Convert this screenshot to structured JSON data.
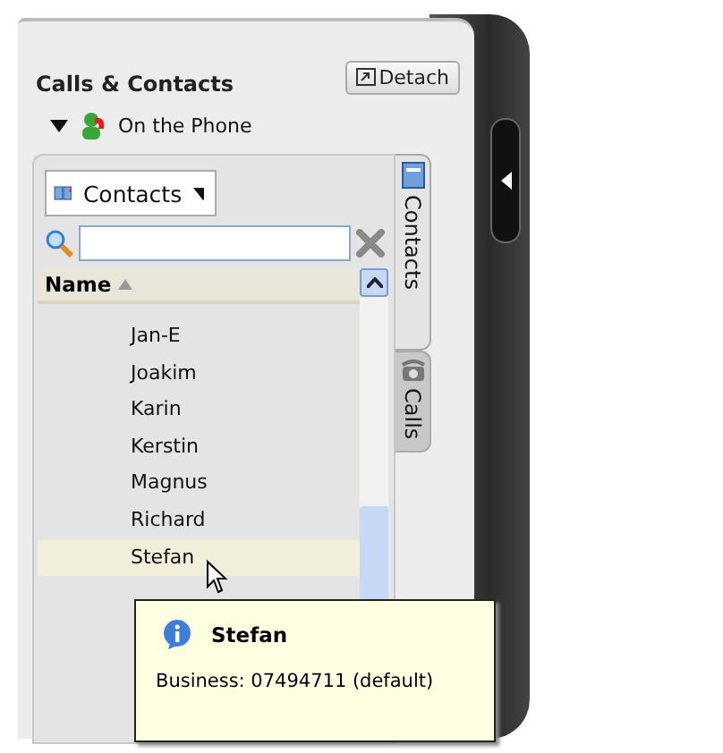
{
  "panel": {
    "title": "Calls & Contacts",
    "detach_button": "Detach"
  },
  "status": {
    "label": "On the Phone"
  },
  "source_dropdown": {
    "label": "Contacts"
  },
  "list": {
    "header": "Name",
    "sort_ascending": true,
    "rows": [
      {
        "name": "Jan-E",
        "selected": false
      },
      {
        "name": "Joakim",
        "selected": false
      },
      {
        "name": "Karin",
        "selected": false
      },
      {
        "name": "Kerstin",
        "selected": false
      },
      {
        "name": "Magnus",
        "selected": false
      },
      {
        "name": "Richard",
        "selected": false
      },
      {
        "name": "Stefan",
        "selected": true
      }
    ]
  },
  "tabs": [
    {
      "label": "Contacts",
      "kind": "contacts",
      "selected": true
    },
    {
      "label": "Calls",
      "kind": "calls",
      "selected": false
    }
  ],
  "tooltip": {
    "name": "Stefan",
    "detail": "Business: 07494711 (default)"
  }
}
